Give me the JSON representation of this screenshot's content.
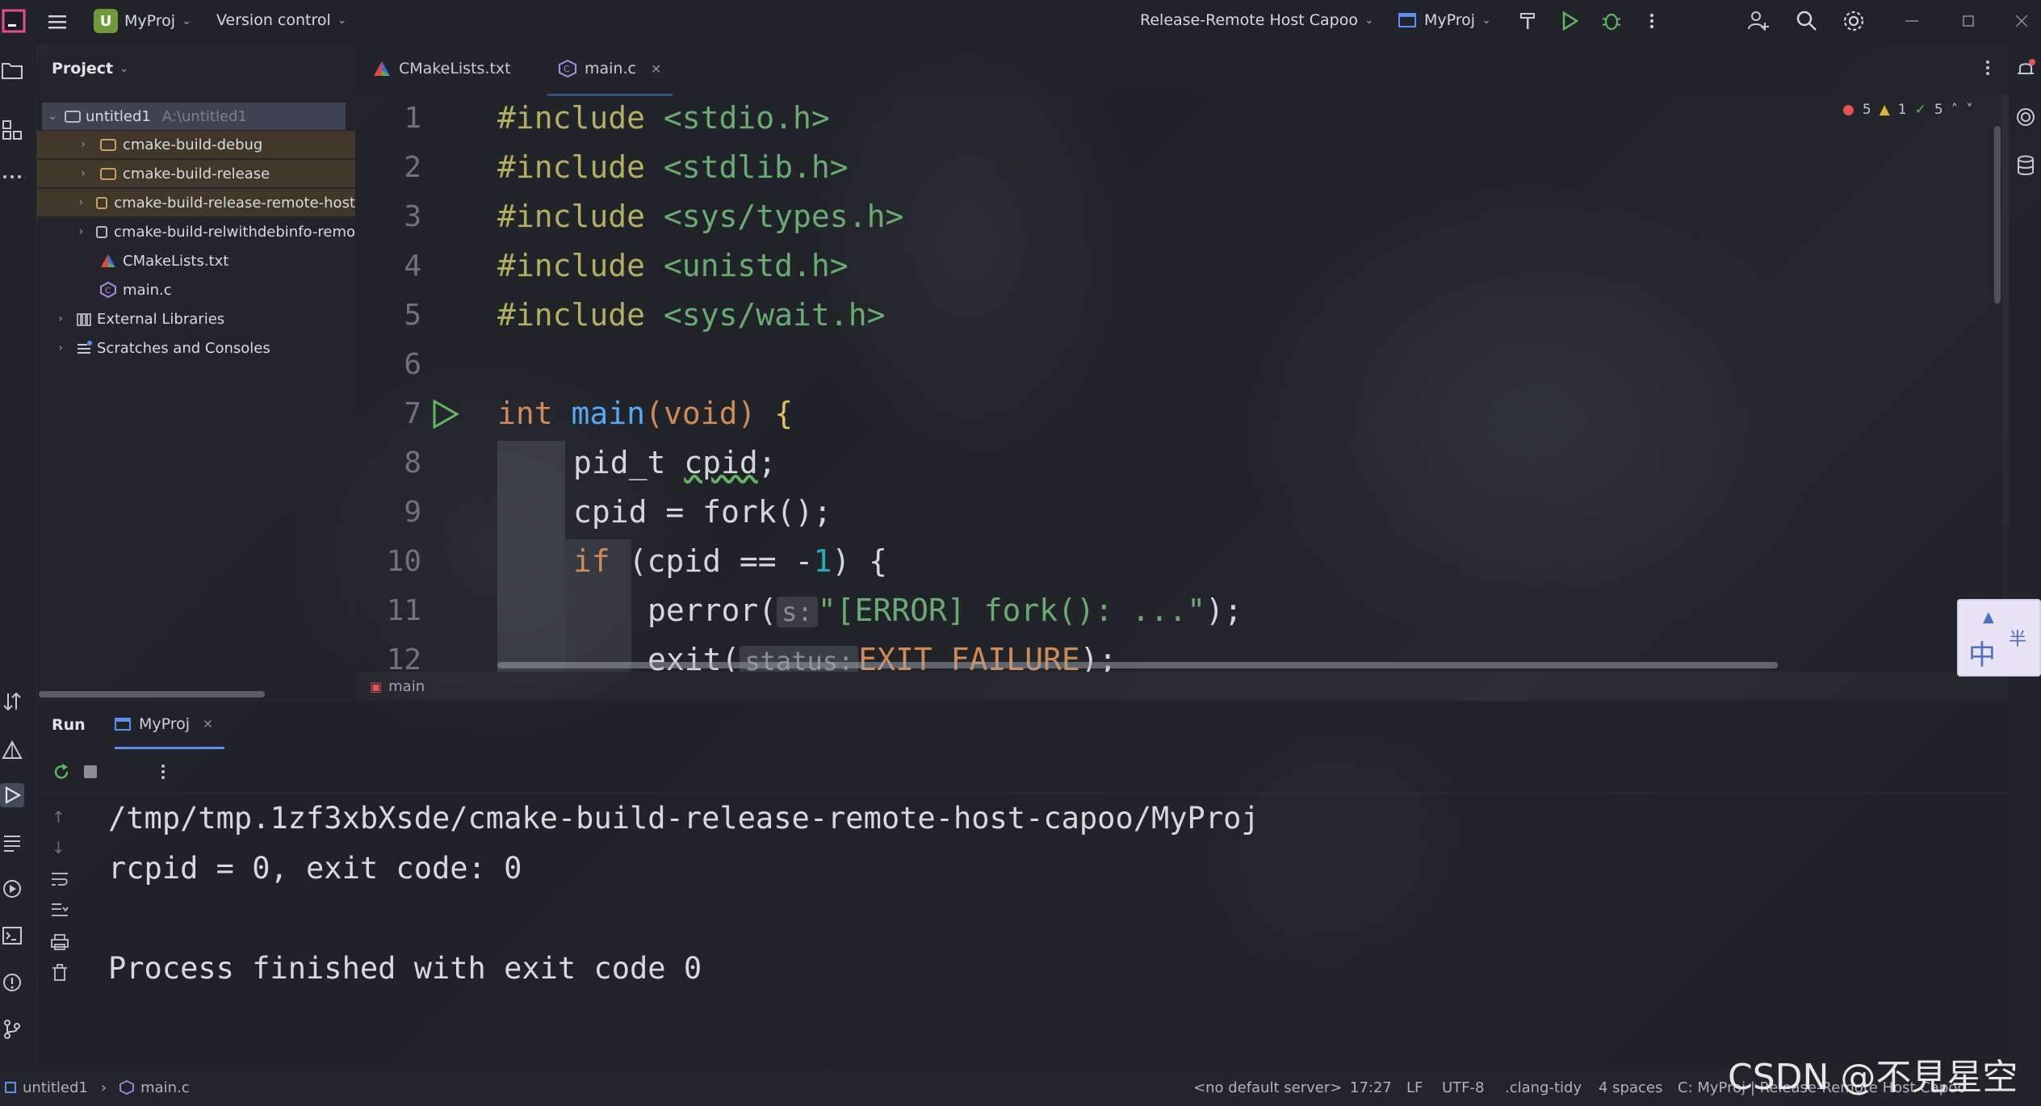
{
  "title_bar": {
    "project_badge": "U",
    "project_name": "MyProj",
    "version_control": "Version control",
    "run_config": "Release-Remote Host Capoo",
    "target": "MyProj"
  },
  "project_panel": {
    "title": "Project",
    "tree": [
      {
        "label": "untitled1",
        "suffix": "A:\\untitled1"
      },
      {
        "label": "cmake-build-debug"
      },
      {
        "label": "cmake-build-release"
      },
      {
        "label": "cmake-build-release-remote-host"
      },
      {
        "label": "cmake-build-relwithdebinfo-remo"
      },
      {
        "label": "CMakeLists.txt"
      },
      {
        "label": "main.c"
      },
      {
        "label": "External Libraries"
      },
      {
        "label": "Scratches and Consoles"
      }
    ]
  },
  "editor": {
    "tabs": [
      {
        "label": "CMakeLists.txt"
      },
      {
        "label": "main.c"
      }
    ],
    "inspections": {
      "errors": "5",
      "warnings": "1",
      "ok": "5"
    },
    "line_numbers": [
      "1",
      "2",
      "3",
      "4",
      "5",
      "6",
      "7",
      "8",
      "9",
      "10",
      "11",
      "12"
    ],
    "code": {
      "l1_dir": "#include",
      "l1_file": " <stdio.h>",
      "l2_dir": "#include",
      "l2_file": " <stdlib.h>",
      "l3_dir": "#include",
      "l3_file": " <sys/types.h>",
      "l4_dir": "#include",
      "l4_file": " <unistd.h>",
      "l5_dir": "#include",
      "l5_file": " <sys/wait.h>",
      "l7_type": "int",
      "l7_fn": "main",
      "l7_rest": "(void) {",
      "l7_void": "void",
      "l8": "pid_t ",
      "l8_var": "cpid",
      "l8_end": ";",
      "l9_a": "cpid = ",
      "l9_fn": "fork",
      "l9_end": "();",
      "l10_kw": "if",
      "l10_a": " (cpid == -",
      "l10_num": "1",
      "l10_end": ") {",
      "l11_fn": "perror(",
      "l11_hint": "s:",
      "l11_str": "\"[ERROR] fork(): ...\"",
      "l11_end": ");",
      "l12_fn": "exit(",
      "l12_hint": "status:",
      "l12_const": "EXIT_FAILURE",
      "l12_end": ");"
    },
    "breadcrumb": "main"
  },
  "run_panel": {
    "title": "Run",
    "tab": "MyProj",
    "output": [
      "/tmp/tmp.1zf3xbXsde/cmake-build-release-remote-host-capoo/MyProj",
      "rcpid = 0, exit code: 0",
      "",
      "Process finished with exit code 0"
    ]
  },
  "status_bar": {
    "crumb_project": "untitled1",
    "crumb_file": "main.c",
    "server": "<no default server>",
    "position": "17:27",
    "line_sep": "LF",
    "encoding": "UTF-8",
    "linter": ".clang-tidy",
    "indent": "4 spaces",
    "context": "C: MyProj | Release-Remote Host Capoo"
  },
  "watermark": "CSDN @不見星空",
  "ime": {
    "main": "中",
    "half": "半"
  }
}
